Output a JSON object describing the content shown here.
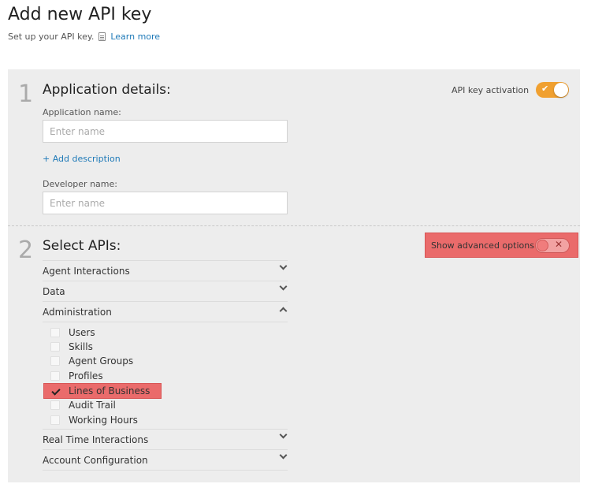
{
  "header": {
    "title": "Add new API key",
    "subtitle": "Set up your API key.",
    "learn_more": "Learn more",
    "doc_icon": "document-icon"
  },
  "section1": {
    "number": "1",
    "title": "Application details:",
    "activation_label": "API key activation",
    "activation_on": true,
    "app_name_label": "Application name:",
    "app_name_placeholder": "Enter name",
    "add_description": "+ Add description",
    "dev_name_label": "Developer name:",
    "dev_name_placeholder": "Enter name"
  },
  "section2": {
    "number": "2",
    "title": "Select APIs:",
    "advanced_label": "Show advanced options",
    "advanced_on": false,
    "apis": [
      {
        "label": "Agent Interactions",
        "expanded": false
      },
      {
        "label": "Data",
        "expanded": false
      },
      {
        "label": "Administration",
        "expanded": true
      },
      {
        "label": "Real Time Interactions",
        "expanded": false
      },
      {
        "label": "Account Configuration",
        "expanded": false
      }
    ],
    "admin_items": [
      {
        "label": "Users",
        "checked": false
      },
      {
        "label": "Skills",
        "checked": false
      },
      {
        "label": "Agent Groups",
        "checked": false
      },
      {
        "label": "Profiles",
        "checked": false
      },
      {
        "label": "Lines of Business",
        "checked": true
      },
      {
        "label": "Audit Trail",
        "checked": false
      },
      {
        "label": "Working Hours",
        "checked": false
      }
    ]
  },
  "colors": {
    "accent_orange": "#f0a030",
    "link_blue": "#1f7ab8",
    "highlight_red": "#ea6b6b",
    "panel_bg": "#ededed"
  }
}
